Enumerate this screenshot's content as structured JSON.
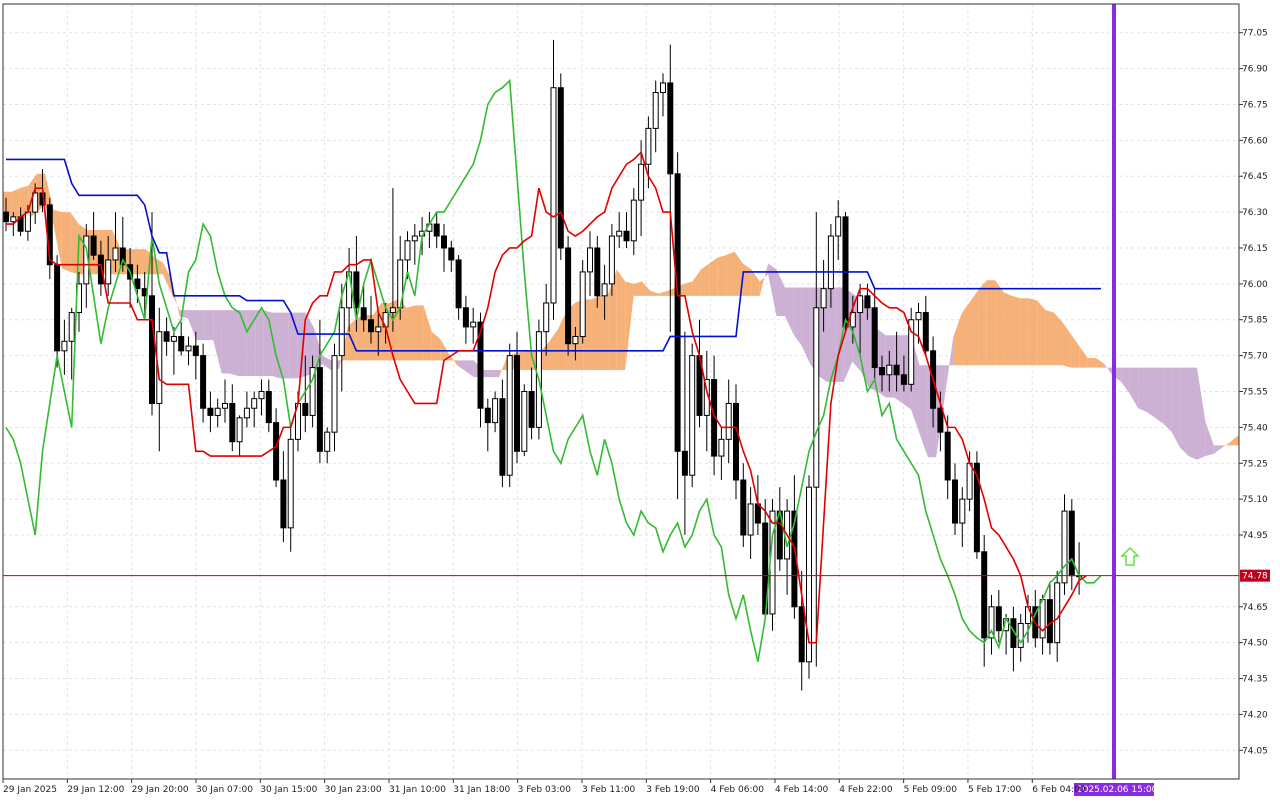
{
  "chart_data": {
    "type": "candlestick",
    "y_axis": {
      "range": [
        73.93,
        77.17
      ],
      "tick_labels": [
        "77.05",
        "76.90",
        "76.75",
        "76.60",
        "76.45",
        "76.30",
        "76.15",
        "76.00",
        "75.85",
        "75.70",
        "75.55",
        "75.40",
        "75.25",
        "75.10",
        "74.95",
        "74.65",
        "74.50",
        "74.35",
        "74.20",
        "74.05"
      ],
      "tick_values": [
        77.05,
        76.9,
        76.75,
        76.6,
        76.45,
        76.3,
        76.15,
        76.0,
        75.85,
        75.7,
        75.55,
        75.4,
        75.25,
        75.1,
        74.95,
        74.65,
        74.5,
        74.35,
        74.2,
        74.05
      ]
    },
    "x_axis": {
      "tick_labels": [
        "29 Jan 2025",
        "29 Jan 12:00",
        "29 Jan 20:00",
        "30 Jan 07:00",
        "30 Jan 15:00",
        "30 Jan 23:00",
        "31 Jan 10:00",
        "31 Jan 18:00",
        "3 Feb 03:00",
        "3 Feb 11:00",
        "3 Feb 19:00",
        "4 Feb 06:00",
        "4 Feb 14:00",
        "4 Feb 22:00",
        "5 Feb 09:00",
        "5 Feb 17:00",
        "6 Feb 04:00"
      ]
    },
    "grid": true,
    "current_price": {
      "value": 74.78,
      "label": "74.78",
      "color": "#c0001a"
    },
    "time_marker": {
      "label": "2025.02.06 15:00",
      "color": "#8a2be2"
    },
    "signal": {
      "type": "up-arrow",
      "color": "#66dd44"
    },
    "series_colors": {
      "tenkan": "#e00000",
      "kijun": "#0010d0",
      "chikou": "#33bb33",
      "cloud_bearish": "#c3a3cc",
      "cloud_bullish": "#f4a360",
      "candle_bull": "#ffffff",
      "candle_bear": "#000000"
    },
    "candles": [
      [
        76.3,
        76.36,
        76.22,
        76.26
      ],
      [
        76.26,
        76.3,
        76.2,
        76.28
      ],
      [
        76.28,
        76.32,
        76.2,
        76.22
      ],
      [
        76.22,
        76.33,
        76.18,
        76.3
      ],
      [
        76.3,
        76.42,
        76.25,
        76.38
      ],
      [
        76.38,
        76.48,
        76.3,
        76.33
      ],
      [
        76.33,
        76.36,
        76.02,
        76.08
      ],
      [
        76.08,
        76.12,
        75.65,
        75.72
      ],
      [
        75.72,
        75.85,
        75.62,
        75.76
      ],
      [
        75.76,
        75.9,
        75.6,
        75.88
      ],
      [
        75.88,
        76.05,
        75.8,
        76.0
      ],
      [
        76.0,
        76.25,
        75.9,
        76.2
      ],
      [
        76.2,
        76.3,
        76.1,
        76.12
      ],
      [
        76.12,
        76.18,
        75.95,
        76.0
      ],
      [
        76.0,
        76.2,
        75.95,
        76.1
      ],
      [
        76.1,
        76.3,
        76.05,
        76.15
      ],
      [
        76.15,
        76.28,
        76.05,
        76.08
      ],
      [
        76.08,
        76.15,
        75.9,
        76.02
      ],
      [
        76.02,
        76.08,
        75.92,
        75.98
      ],
      [
        75.98,
        76.05,
        75.85,
        75.95
      ],
      [
        75.95,
        76.3,
        75.45,
        75.5
      ],
      [
        75.5,
        75.9,
        75.3,
        75.8
      ],
      [
        75.8,
        75.86,
        75.7,
        75.76
      ],
      [
        75.76,
        75.82,
        75.62,
        75.78
      ],
      [
        75.78,
        75.84,
        75.7,
        75.72
      ],
      [
        75.72,
        75.78,
        75.66,
        75.74
      ],
      [
        75.74,
        75.8,
        75.6,
        75.7
      ],
      [
        75.7,
        75.75,
        75.42,
        75.48
      ],
      [
        75.48,
        75.55,
        75.38,
        75.45
      ],
      [
        75.45,
        75.52,
        75.4,
        75.48
      ],
      [
        75.48,
        75.6,
        75.42,
        75.5
      ],
      [
        75.5,
        75.58,
        75.3,
        75.34
      ],
      [
        75.34,
        75.45,
        75.28,
        75.44
      ],
      [
        75.44,
        75.55,
        75.4,
        75.48
      ],
      [
        75.48,
        75.55,
        75.4,
        75.52
      ],
      [
        75.52,
        75.6,
        75.45,
        75.55
      ],
      [
        75.55,
        75.6,
        75.38,
        75.42
      ],
      [
        75.42,
        75.48,
        75.15,
        75.18
      ],
      [
        75.18,
        75.3,
        74.92,
        74.98
      ],
      [
        74.98,
        75.4,
        74.88,
        75.35
      ],
      [
        75.35,
        75.55,
        75.3,
        75.5
      ],
      [
        75.5,
        75.7,
        75.38,
        75.45
      ],
      [
        75.45,
        75.7,
        75.4,
        75.65
      ],
      [
        75.65,
        75.85,
        75.25,
        75.3
      ],
      [
        75.3,
        75.4,
        75.25,
        75.38
      ],
      [
        75.38,
        75.75,
        75.3,
        75.7
      ],
      [
        75.7,
        76.0,
        75.55,
        75.9
      ],
      [
        75.9,
        76.15,
        75.8,
        76.05
      ],
      [
        76.05,
        76.2,
        75.8,
        75.9
      ],
      [
        75.9,
        76.0,
        75.8,
        75.85
      ],
      [
        75.85,
        75.95,
        75.75,
        75.8
      ],
      [
        75.8,
        75.88,
        75.7,
        75.82
      ],
      [
        75.82,
        75.92,
        75.75,
        75.88
      ],
      [
        75.88,
        76.4,
        75.8,
        75.9
      ],
      [
        75.9,
        76.2,
        75.85,
        76.1
      ],
      [
        76.1,
        76.22,
        76.02,
        76.18
      ],
      [
        76.18,
        76.25,
        76.08,
        76.2
      ],
      [
        76.2,
        76.28,
        76.12,
        76.22
      ],
      [
        76.22,
        76.3,
        76.15,
        76.25
      ],
      [
        76.25,
        76.3,
        76.15,
        76.2
      ],
      [
        76.2,
        76.25,
        76.05,
        76.15
      ],
      [
        76.15,
        76.18,
        76.05,
        76.1
      ],
      [
        76.1,
        76.12,
        75.85,
        75.9
      ],
      [
        75.9,
        75.95,
        75.75,
        75.82
      ],
      [
        75.82,
        75.9,
        75.75,
        75.84
      ],
      [
        75.84,
        75.88,
        75.4,
        75.48
      ],
      [
        75.48,
        75.52,
        75.3,
        75.42
      ],
      [
        75.42,
        75.55,
        75.38,
        75.52
      ],
      [
        75.52,
        75.6,
        75.15,
        75.2
      ],
      [
        75.2,
        75.75,
        75.15,
        75.7
      ],
      [
        75.7,
        75.8,
        75.25,
        75.3
      ],
      [
        75.3,
        75.58,
        75.28,
        75.55
      ],
      [
        75.55,
        75.65,
        75.35,
        75.4
      ],
      [
        75.4,
        75.85,
        75.35,
        75.8
      ],
      [
        75.8,
        76.0,
        75.7,
        75.92
      ],
      [
        75.92,
        77.02,
        75.85,
        76.82
      ],
      [
        76.82,
        76.88,
        76.1,
        76.15
      ],
      [
        76.15,
        76.2,
        75.7,
        75.75
      ],
      [
        75.75,
        75.82,
        75.68,
        75.78
      ],
      [
        75.78,
        76.1,
        75.75,
        76.05
      ],
      [
        76.05,
        76.22,
        75.95,
        76.15
      ],
      [
        76.15,
        76.2,
        75.9,
        75.95
      ],
      [
        75.95,
        76.08,
        75.85,
        76.0
      ],
      [
        76.0,
        76.25,
        75.95,
        76.2
      ],
      [
        76.2,
        76.3,
        76.15,
        76.22
      ],
      [
        76.22,
        76.3,
        76.15,
        76.18
      ],
      [
        76.18,
        76.4,
        76.12,
        76.35
      ],
      [
        76.35,
        76.6,
        76.2,
        76.5
      ],
      [
        76.5,
        76.7,
        76.4,
        76.65
      ],
      [
        76.65,
        76.85,
        76.55,
        76.8
      ],
      [
        76.8,
        76.88,
        76.7,
        76.84
      ],
      [
        76.84,
        77.0,
        75.8,
        76.46
      ],
      [
        76.46,
        76.55,
        75.1,
        75.3
      ],
      [
        75.3,
        75.8,
        74.95,
        75.2
      ],
      [
        75.2,
        75.75,
        75.15,
        75.7
      ],
      [
        75.7,
        75.85,
        75.4,
        75.45
      ],
      [
        75.45,
        75.72,
        75.3,
        75.6
      ],
      [
        75.6,
        75.7,
        75.2,
        75.28
      ],
      [
        75.28,
        75.4,
        75.18,
        75.35
      ],
      [
        75.35,
        75.6,
        75.25,
        75.5
      ],
      [
        75.5,
        75.58,
        75.1,
        75.18
      ],
      [
        75.18,
        75.25,
        74.9,
        74.95
      ],
      [
        74.95,
        75.15,
        74.85,
        75.08
      ],
      [
        75.08,
        75.2,
        74.95,
        75.0
      ],
      [
        75.0,
        75.1,
        74.6,
        74.62
      ],
      [
        74.62,
        75.1,
        74.55,
        75.05
      ],
      [
        75.05,
        75.15,
        74.8,
        74.85
      ],
      [
        74.85,
        75.1,
        74.7,
        75.05
      ],
      [
        75.05,
        75.2,
        74.6,
        74.65
      ],
      [
        74.65,
        74.8,
        74.3,
        74.42
      ],
      [
        74.42,
        75.2,
        74.35,
        75.15
      ],
      [
        75.15,
        76.3,
        74.4,
        75.9
      ],
      [
        75.9,
        76.1,
        75.8,
        75.98
      ],
      [
        75.98,
        76.25,
        75.9,
        76.2
      ],
      [
        76.2,
        76.35,
        76.1,
        76.28
      ],
      [
        76.28,
        76.3,
        75.8,
        75.82
      ],
      [
        75.82,
        75.95,
        75.75,
        75.88
      ],
      [
        75.88,
        76.0,
        75.7,
        75.95
      ],
      [
        75.95,
        76.0,
        75.85,
        75.9
      ],
      [
        75.9,
        75.98,
        75.6,
        75.65
      ],
      [
        75.65,
        75.7,
        75.55,
        75.62
      ],
      [
        75.62,
        75.72,
        75.55,
        75.66
      ],
      [
        75.66,
        75.8,
        75.55,
        75.62
      ],
      [
        75.62,
        75.7,
        75.55,
        75.58
      ],
      [
        75.58,
        75.9,
        75.55,
        75.85
      ],
      [
        75.85,
        75.92,
        75.75,
        75.88
      ],
      [
        75.88,
        75.95,
        75.7,
        75.72
      ],
      [
        75.72,
        75.78,
        75.4,
        75.48
      ],
      [
        75.48,
        75.55,
        75.3,
        75.38
      ],
      [
        75.38,
        75.45,
        75.1,
        75.18
      ],
      [
        75.18,
        75.25,
        74.95,
        75.0
      ],
      [
        75.0,
        75.15,
        74.9,
        75.1
      ],
      [
        75.1,
        75.3,
        75.05,
        75.25
      ],
      [
        75.25,
        75.3,
        74.85,
        74.88
      ],
      [
        74.88,
        74.95,
        74.4,
        74.52
      ],
      [
        74.52,
        74.7,
        74.45,
        74.65
      ],
      [
        74.65,
        74.72,
        74.5,
        74.55
      ],
      [
        74.55,
        74.62,
        74.45,
        74.6
      ],
      [
        74.6,
        74.65,
        74.38,
        74.48
      ],
      [
        74.48,
        74.62,
        74.42,
        74.58
      ],
      [
        74.58,
        74.7,
        74.5,
        74.65
      ],
      [
        74.65,
        74.72,
        74.48,
        74.52
      ],
      [
        74.52,
        74.7,
        74.45,
        74.68
      ],
      [
        74.68,
        74.75,
        74.45,
        74.5
      ],
      [
        74.5,
        74.8,
        74.42,
        74.75
      ],
      [
        74.75,
        75.12,
        74.7,
        75.05
      ],
      [
        75.05,
        75.1,
        74.72,
        74.78
      ],
      [
        74.78,
        74.92,
        74.7,
        74.78
      ]
    ],
    "tenkan": [
      76.25,
      76.25,
      76.28,
      76.3,
      76.4,
      76.4,
      76.1,
      76.08,
      76.08,
      76.08,
      76.08,
      76.08,
      76.08,
      76.08,
      75.92,
      75.92,
      75.92,
      75.92,
      75.85,
      75.85,
      75.85,
      75.6,
      75.58,
      75.58,
      75.58,
      75.58,
      75.3,
      75.3,
      75.28,
      75.28,
      75.28,
      75.28,
      75.28,
      75.28,
      75.28,
      75.28,
      75.3,
      75.32,
      75.4,
      75.4,
      75.5,
      75.85,
      75.92,
      75.95,
      75.95,
      76.05,
      76.05,
      76.08,
      76.08,
      76.1,
      76.1,
      75.88,
      75.82,
      75.7,
      75.6,
      75.55,
      75.5,
      75.5,
      75.5,
      75.5,
      75.68,
      75.7,
      75.72,
      75.72,
      75.72,
      75.8,
      75.9,
      76.05,
      76.12,
      76.15,
      76.15,
      76.18,
      76.2,
      76.4,
      76.3,
      76.28,
      76.3,
      76.22,
      76.2,
      76.22,
      76.25,
      76.28,
      76.3,
      76.4,
      76.45,
      76.5,
      76.52,
      76.55,
      76.45,
      76.4,
      76.3,
      76.3,
      75.95,
      75.95,
      75.8,
      75.7,
      75.55,
      75.45,
      75.4,
      75.4,
      75.4,
      75.3,
      75.22,
      75.08,
      75.05,
      75.0,
      75.0,
      74.95,
      74.9,
      74.7,
      74.5,
      74.5,
      75.0,
      75.5,
      75.7,
      75.8,
      75.9,
      75.98,
      75.98,
      75.95,
      75.92,
      75.9,
      75.9,
      75.88,
      75.8,
      75.78,
      75.7,
      75.6,
      75.5,
      75.4,
      75.4,
      75.35,
      75.25,
      75.2,
      75.1,
      74.98,
      74.95,
      74.9,
      74.85,
      74.78,
      74.65,
      74.58,
      74.55,
      74.58,
      74.6,
      74.65,
      74.7,
      74.76,
      74.78
    ],
    "kijun": [
      76.52,
      76.52,
      76.52,
      76.52,
      76.52,
      76.52,
      76.52,
      76.52,
      76.52,
      76.42,
      76.37,
      76.37,
      76.37,
      76.37,
      76.37,
      76.37,
      76.37,
      76.37,
      76.37,
      76.33,
      76.2,
      76.13,
      76.13,
      75.95,
      75.95,
      75.95,
      75.95,
      75.95,
      75.95,
      75.95,
      75.95,
      75.95,
      75.95,
      75.93,
      75.93,
      75.93,
      75.93,
      75.93,
      75.93,
      75.88,
      75.79,
      75.79,
      75.79,
      75.79,
      75.79,
      75.79,
      75.79,
      75.79,
      75.72,
      75.72,
      75.72,
      75.72,
      75.72,
      75.72,
      75.72,
      75.72,
      75.72,
      75.72,
      75.72,
      75.72,
      75.72,
      75.72,
      75.72,
      75.72,
      75.72,
      75.72,
      75.72,
      75.72,
      75.72,
      75.72,
      75.72,
      75.72,
      75.72,
      75.72,
      75.72,
      75.72,
      75.72,
      75.72,
      75.72,
      75.72,
      75.72,
      75.72,
      75.72,
      75.72,
      75.72,
      75.72,
      75.72,
      75.72,
      75.72,
      75.72,
      75.72,
      75.78,
      75.78,
      75.78,
      75.78,
      75.78,
      75.78,
      75.78,
      75.78,
      75.78,
      75.78,
      76.05,
      76.05,
      76.05,
      76.05,
      76.05,
      76.05,
      76.05,
      76.05,
      76.05,
      76.05,
      76.05,
      76.05,
      76.05,
      76.05,
      76.05,
      76.05,
      76.05,
      76.05,
      75.98,
      75.98,
      75.98,
      75.98,
      75.98,
      75.98,
      75.98,
      75.98,
      75.98,
      75.98,
      75.98,
      75.98,
      75.98,
      75.98,
      75.98,
      75.98,
      75.98,
      75.98,
      75.98,
      75.98,
      75.98,
      75.98,
      75.98,
      75.98,
      75.98,
      75.98,
      75.98,
      75.98,
      75.98,
      75.98,
      75.98,
      75.98
    ],
    "chikou": [
      75.4,
      75.35,
      75.25,
      75.1,
      74.95,
      75.3,
      75.5,
      75.7,
      75.55,
      75.4,
      76.2,
      76.15,
      75.95,
      75.75,
      75.9,
      76.0,
      76.1,
      76.05,
      75.95,
      75.85,
      76.2,
      76.0,
      75.9,
      75.8,
      75.85,
      76.05,
      76.1,
      76.25,
      76.2,
      76.05,
      75.95,
      75.9,
      75.88,
      75.8,
      75.85,
      75.9,
      75.85,
      75.7,
      75.6,
      75.4,
      75.5,
      75.55,
      75.6,
      75.7,
      75.75,
      75.8,
      75.95,
      76.05,
      75.85,
      76.0,
      76.1,
      76.0,
      75.9,
      75.85,
      75.9,
      76.05,
      75.95,
      76.2,
      76.25,
      76.3,
      76.3,
      76.35,
      76.4,
      76.45,
      76.5,
      76.6,
      76.75,
      76.8,
      76.82,
      76.85,
      76.45,
      76.05,
      75.7,
      75.6,
      75.45,
      75.3,
      75.25,
      75.35,
      75.4,
      75.45,
      75.3,
      75.2,
      75.35,
      75.25,
      75.1,
      75.0,
      74.95,
      75.05,
      75.0,
      74.98,
      74.88,
      74.95,
      75.0,
      74.9,
      74.95,
      75.05,
      75.1,
      74.95,
      74.9,
      74.7,
      74.6,
      74.7,
      74.55,
      74.42,
      74.6,
      74.95,
      75.05,
      74.9,
      75.0,
      75.15,
      75.3,
      75.38,
      75.45,
      75.6,
      75.7,
      75.85,
      75.8,
      75.7,
      75.55,
      75.6,
      75.45,
      75.5,
      75.35,
      75.3,
      75.25,
      75.2,
      75.05,
      74.95,
      74.85,
      74.78,
      74.7,
      74.6,
      74.55,
      74.52,
      74.5,
      74.55,
      74.48,
      74.6,
      74.55,
      74.5,
      74.55,
      74.62,
      74.68,
      74.75,
      74.78,
      74.82,
      74.85,
      74.78,
      74.75,
      74.75,
      74.78
    ]
  }
}
